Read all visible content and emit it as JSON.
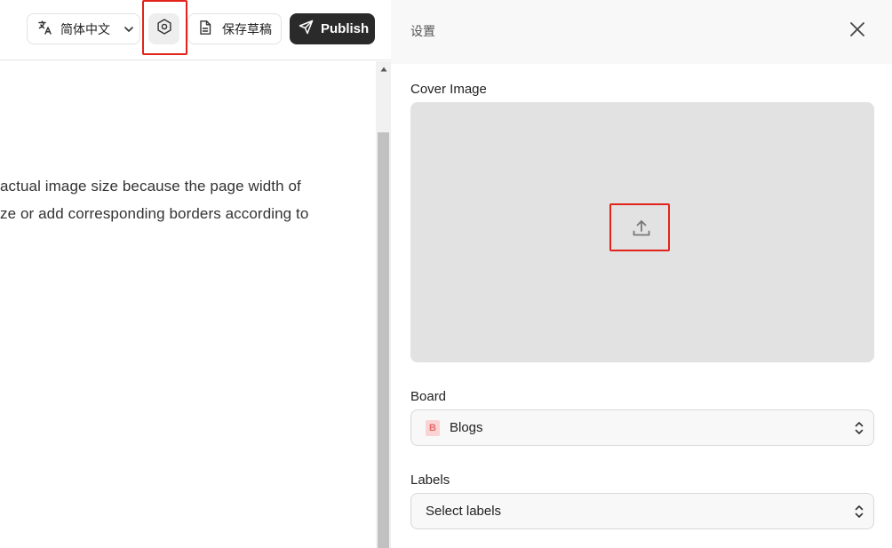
{
  "toolbar": {
    "language_label": "简体中文",
    "save_draft_label": "保存草稿",
    "publish_label": "Publish"
  },
  "editor": {
    "line1": "actual image size because the page width of",
    "line2": "ze or add corresponding borders according to"
  },
  "settings_panel": {
    "title": "设置",
    "cover_image_label": "Cover Image",
    "board_label": "Board",
    "board_badge": "B",
    "board_value": "Blogs",
    "labels_label": "Labels",
    "labels_placeholder": "Select labels"
  },
  "colors": {
    "highlight": "#e2231a",
    "publish_bg": "#2a2a2a",
    "cover_bg": "#e2e2e2",
    "board_badge_bg": "#fad4d4"
  }
}
